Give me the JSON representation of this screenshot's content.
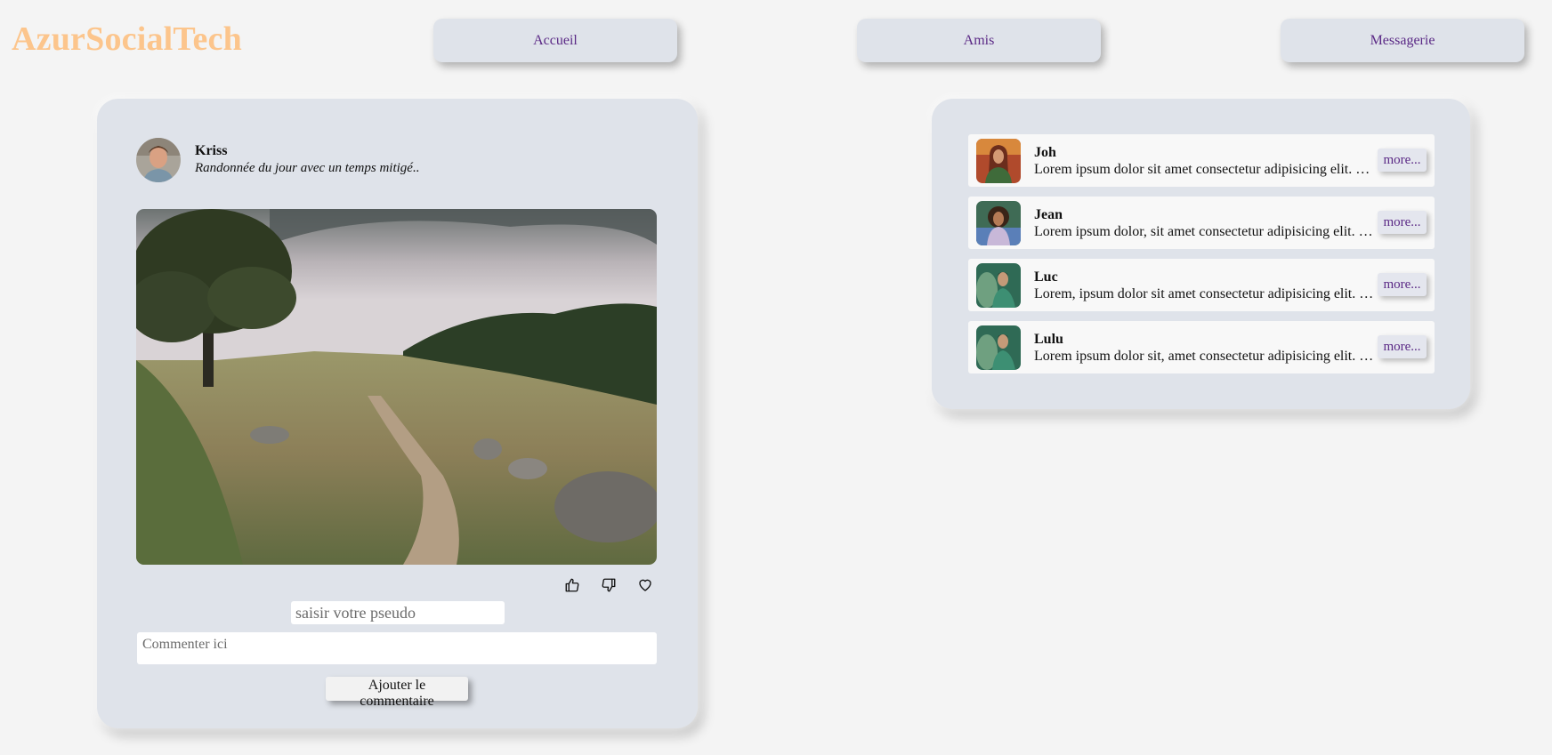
{
  "header": {
    "logo": "AzurSocialTech",
    "nav": [
      {
        "label": "Accueil"
      },
      {
        "label": "Amis"
      },
      {
        "label": "Messagerie"
      }
    ]
  },
  "post": {
    "author": "Kriss",
    "caption": "Randonnée du jour avec un temps mitigé..",
    "image": "landscape-photo",
    "reactions": [
      "thumbs-up-icon",
      "thumbs-down-icon",
      "heart-icon"
    ],
    "pseudo_placeholder": "saisir votre pseudo",
    "comment_placeholder": "Commenter ici",
    "add_comment_label": "Ajouter le commentaire"
  },
  "friends": [
    {
      "name": "Joh",
      "text": "Lorem ipsum dolor sit amet consectetur adipisicing elit. Quisquam",
      "more": "more..."
    },
    {
      "name": "Jean",
      "text": "Lorem ipsum dolor, sit amet consectetur adipisicing elit. Quisquam",
      "more": "more..."
    },
    {
      "name": "Luc",
      "text": "Lorem, ipsum dolor sit amet consectetur adipisicing elit. Quisquam",
      "more": "more..."
    },
    {
      "name": "Lulu",
      "text": "Lorem ipsum dolor sit, amet consectetur adipisicing elit. Quisquam",
      "more": "more..."
    }
  ],
  "colors": {
    "logo": "#fcc58c",
    "card": "#dfe3ea",
    "nav_text": "#5b2a86",
    "background": "#f4f4f4"
  }
}
